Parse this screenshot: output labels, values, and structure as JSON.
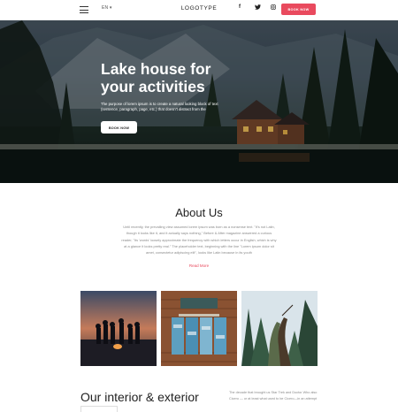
{
  "header": {
    "lang": "EN ▾",
    "logo": "LOGOTYPE",
    "social": {
      "facebook": "f",
      "twitter": "🐦",
      "instagram": "◎"
    },
    "book_now": "BOOK NOW"
  },
  "hero": {
    "title": "Lake house for your activities",
    "text": "The purpose of lorem ipsum is to create a natural looking block of text (sentence, paragraph, page, etc.) that doesn't distract from the",
    "button": "BOOK NOW"
  },
  "about": {
    "title": "About Us",
    "text": "Until recently, the prevailing view assumed lorem ipsum was born as a nonsense text. \"It's not Latin, though it looks like it, and it actually says nothing,\" Before & After magazine answered a curious reader, \"Its 'words' loosely approximate the frequency with which letters occur in English, which is why at a glance it looks pretty real.\" The placeholder text, beginning with the line \"Lorem ipsum dolor sit amet, consectetur adipiscing elit\", looks like Latin because in its youth",
    "read_more": "Read More"
  },
  "interior": {
    "title": "Our interior & exterior",
    "text": "The decade that brought us Star Trek and Doctor Who also Cicero — or at least what used to be Cicero—in an attempt"
  },
  "colors": {
    "accent": "#e94a5e"
  }
}
